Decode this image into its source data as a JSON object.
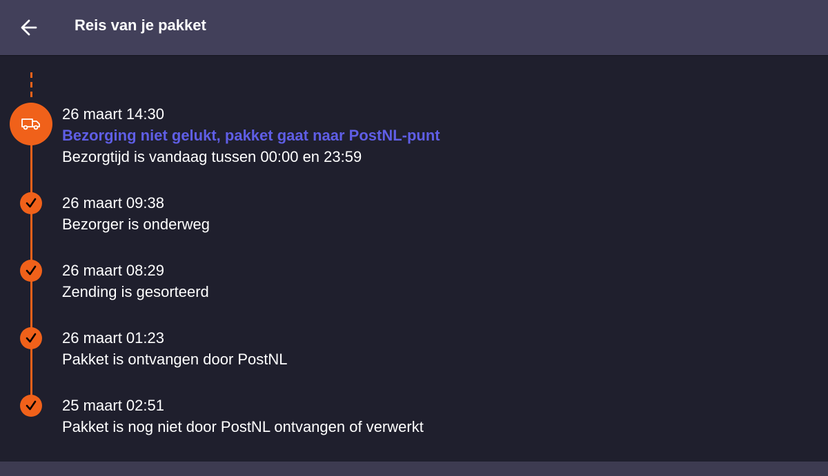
{
  "header": {
    "title": "Reis van je pakket"
  },
  "colors": {
    "accent": "#f0611a",
    "link": "#5f5ee6",
    "header_bg": "#42405a",
    "page_bg": "#1f1f2d"
  },
  "timeline": [
    {
      "icon": "delivery-van-icon",
      "datetime": "26 maart 14:30",
      "status": "Bezorging niet gelukt, pakket gaat naar PostNL-punt",
      "detail": "Bezorgtijd is vandaag tussen 00:00 en 23:59"
    },
    {
      "icon": "checkmark-icon",
      "datetime": "26 maart 09:38",
      "status": "Bezorger is onderweg"
    },
    {
      "icon": "checkmark-icon",
      "datetime": "26 maart 08:29",
      "status": "Zending is gesorteerd"
    },
    {
      "icon": "checkmark-icon",
      "datetime": "26 maart 01:23",
      "status": "Pakket is ontvangen door PostNL"
    },
    {
      "icon": "checkmark-icon",
      "datetime": "25 maart 02:51",
      "status": "Pakket is nog niet door PostNL ontvangen of verwerkt"
    }
  ]
}
